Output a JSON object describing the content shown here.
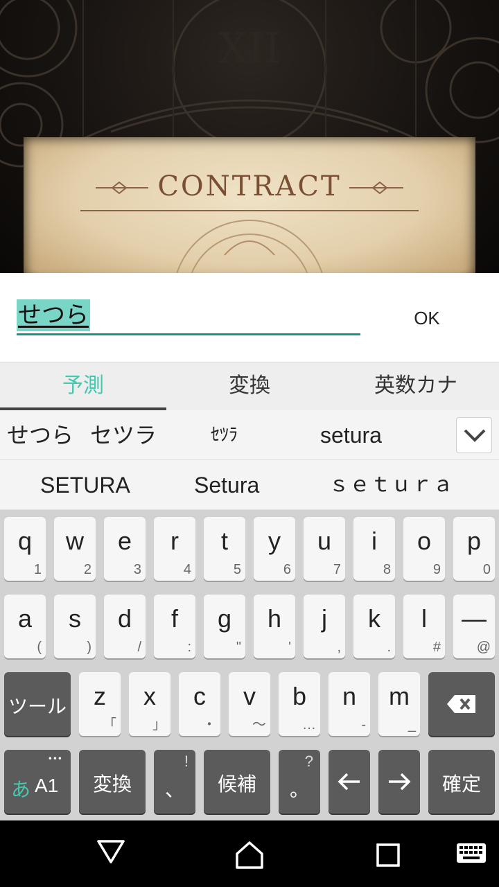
{
  "game": {
    "banner_title": "CONTRACT"
  },
  "input": {
    "composing_text": "せつら",
    "ok_label": "OK"
  },
  "ime_tabs": [
    {
      "label": "予測",
      "active": true
    },
    {
      "label": "変換",
      "active": false
    },
    {
      "label": "英数カナ",
      "active": false
    }
  ],
  "candidates": {
    "row1": [
      "せつら",
      "セツラ",
      "ｾﾂﾗ",
      "setura"
    ],
    "row2": [
      "SETURA",
      "Setura",
      "ｓｅｔｕｒａ"
    ],
    "expand_icon": "chevron-down-icon"
  },
  "keyboard": {
    "row1": [
      {
        "main": "q",
        "sub": "1"
      },
      {
        "main": "w",
        "sub": "2"
      },
      {
        "main": "e",
        "sub": "3"
      },
      {
        "main": "r",
        "sub": "4"
      },
      {
        "main": "t",
        "sub": "5"
      },
      {
        "main": "y",
        "sub": "6"
      },
      {
        "main": "u",
        "sub": "7"
      },
      {
        "main": "i",
        "sub": "8"
      },
      {
        "main": "o",
        "sub": "9"
      },
      {
        "main": "p",
        "sub": "0"
      }
    ],
    "row2": [
      {
        "main": "a",
        "sub": "("
      },
      {
        "main": "s",
        "sub": ")"
      },
      {
        "main": "d",
        "sub": "/"
      },
      {
        "main": "f",
        "sub": ":"
      },
      {
        "main": "g",
        "sub": "\""
      },
      {
        "main": "h",
        "sub": "'"
      },
      {
        "main": "j",
        "sub": ","
      },
      {
        "main": "k",
        "sub": "."
      },
      {
        "main": "l",
        "sub": "#"
      },
      {
        "main": "—",
        "sub": "@"
      }
    ],
    "row3": {
      "tool_label": "ツール",
      "keys": [
        {
          "main": "z",
          "sub": "「"
        },
        {
          "main": "x",
          "sub": "」"
        },
        {
          "main": "c",
          "sub": "・"
        },
        {
          "main": "v",
          "sub": "〜"
        },
        {
          "main": "b",
          "sub": "…"
        },
        {
          "main": "n",
          "sub": "-"
        },
        {
          "main": "m",
          "sub": "_"
        }
      ],
      "backspace_icon": "backspace-icon"
    },
    "row4": {
      "mode_label_kana": "あ",
      "mode_label_alpha": "A1",
      "mode_dots": "•••",
      "convert_label": "変換",
      "comma_main": "、",
      "comma_sub": "!",
      "candidate_label": "候補",
      "period_main": "。",
      "period_sub": "?",
      "left_icon": "arrow-left-icon",
      "right_icon": "arrow-right-icon",
      "confirm_label": "確定"
    }
  },
  "nav": {
    "back_icon": "back-triangle-icon",
    "home_icon": "home-icon",
    "recents_icon": "recents-square-icon",
    "keyboard_icon": "keyboard-icon"
  },
  "colors": {
    "accent": "#1a9184",
    "composing_highlight": "#79d5c6",
    "active_tab": "#45c8ae"
  }
}
